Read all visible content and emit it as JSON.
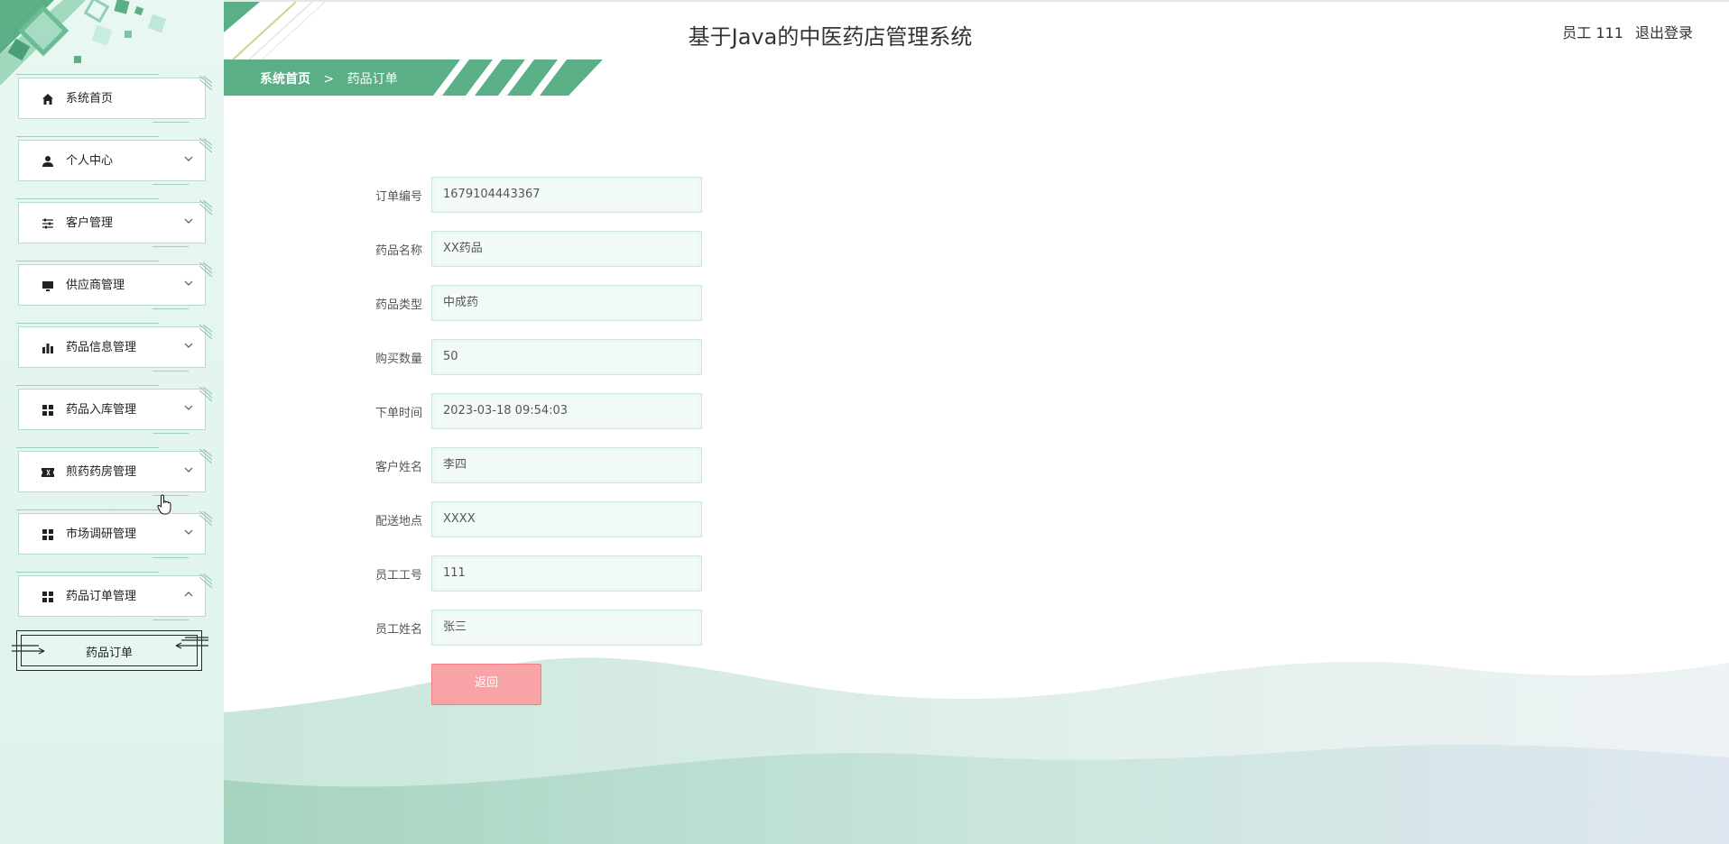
{
  "header": {
    "title": "基于Java的中医药店管理系统",
    "user_label": "员工 111",
    "logout_label": "退出登录"
  },
  "breadcrumb": {
    "home": "系统首页",
    "separator": ">",
    "current": "药品订单"
  },
  "sidebar": {
    "items": [
      {
        "label": "系统首页",
        "icon": "home-icon"
      },
      {
        "label": "个人中心",
        "icon": "user-icon"
      },
      {
        "label": "客户管理",
        "icon": "sliders-icon"
      },
      {
        "label": "供应商管理",
        "icon": "monitor-icon"
      },
      {
        "label": "药品信息管理",
        "icon": "bar-chart-icon"
      },
      {
        "label": "药品入库管理",
        "icon": "grid-icon"
      },
      {
        "label": "煎药药房管理",
        "icon": "ticket-icon"
      },
      {
        "label": "市场调研管理",
        "icon": "grid-icon"
      },
      {
        "label": "药品订单管理",
        "icon": "grid-icon"
      }
    ],
    "subitem": {
      "label": "药品订单"
    }
  },
  "form": {
    "fields": [
      {
        "label": "订单编号",
        "value": "1679104443367"
      },
      {
        "label": "药品名称",
        "value": "XX药品"
      },
      {
        "label": "药品类型",
        "value": "中成药"
      },
      {
        "label": "购买数量",
        "value": "50"
      },
      {
        "label": "下单时间",
        "value": "2023-03-18 09:54:03"
      },
      {
        "label": "客户姓名",
        "value": "李四"
      },
      {
        "label": "配送地点",
        "value": "XXXX"
      },
      {
        "label": "员工工号",
        "value": "111"
      },
      {
        "label": "员工姓名",
        "value": "张三"
      }
    ],
    "back_label": "返回"
  },
  "colors": {
    "accent": "#5aaf86",
    "sidebar_bg": "#e3f5ee",
    "input_border": "#cfe9df",
    "back_button": "#f8a3a6"
  }
}
